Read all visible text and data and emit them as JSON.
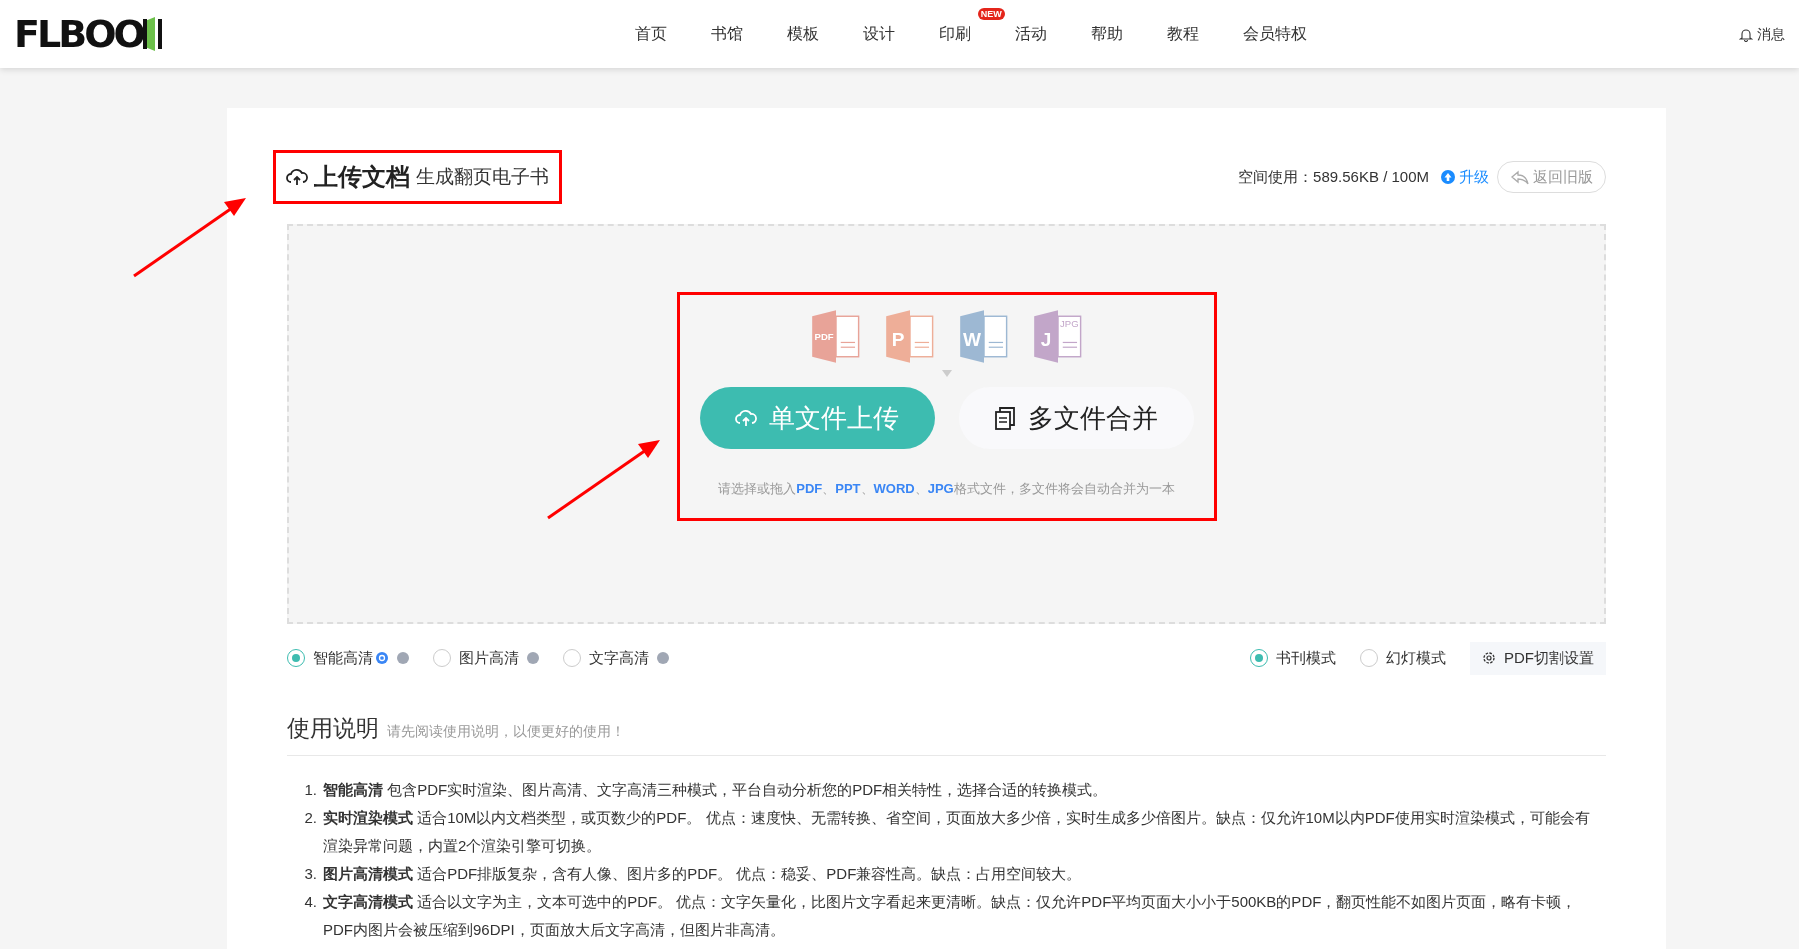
{
  "header": {
    "logo": "FLBOO",
    "nav": [
      {
        "label": "首页"
      },
      {
        "label": "书馆"
      },
      {
        "label": "模板"
      },
      {
        "label": "设计"
      },
      {
        "label": "印刷",
        "badge": "NEW"
      },
      {
        "label": "活动"
      },
      {
        "label": "帮助"
      },
      {
        "label": "教程"
      },
      {
        "label": "会员特权"
      }
    ],
    "messages": "消息"
  },
  "upload": {
    "title": "上传文档",
    "subtitle": "生成翻页电子书",
    "storage": "空间使用：589.56KB / 100M",
    "upgrade": "升级",
    "old_version": "返回旧版",
    "file_types": [
      {
        "label": "PDF",
        "color": "#e8a398"
      },
      {
        "label": "P",
        "color": "#eeae98"
      },
      {
        "label": "W",
        "color": "#9db8d3"
      },
      {
        "label": "J",
        "sublabel": "JPG",
        "color": "#c2a6c9"
      }
    ],
    "buttons": [
      {
        "label": "单文件上传",
        "kind": "primary"
      },
      {
        "label": "多文件合并",
        "kind": "secondary"
      }
    ],
    "hint": [
      {
        "text": "请选择或拖入",
        "kind": "plain"
      },
      {
        "text": "PDF",
        "kind": "format"
      },
      {
        "text": "、",
        "kind": "plain"
      },
      {
        "text": "PPT",
        "kind": "format"
      },
      {
        "text": "、",
        "kind": "plain"
      },
      {
        "text": "WORD",
        "kind": "format"
      },
      {
        "text": "、",
        "kind": "plain"
      },
      {
        "text": "JPG",
        "kind": "format"
      },
      {
        "text": "格式文件，多文件将会自动合并为一本",
        "kind": "plain"
      }
    ]
  },
  "quality_options": [
    {
      "label": "智能高清",
      "selected": true,
      "featured": true
    },
    {
      "label": "图片高清",
      "selected": false,
      "featured": false
    },
    {
      "label": "文字高清",
      "selected": false,
      "featured": false
    }
  ],
  "view_modes": [
    {
      "label": "书刊模式",
      "selected": true
    },
    {
      "label": "幻灯模式",
      "selected": false
    }
  ],
  "split_settings": "PDF切割设置",
  "instructions": {
    "title": "使用说明",
    "subtitle": "请先阅读使用说明，以便更好的使用！",
    "items": [
      {
        "number": "1.",
        "text": "**智能高清** 包含PDF实时渲染、图片高清、文字高清三种模式，平台自动分析您的PDF相关特性，选择合适的转换模式。"
      },
      {
        "number": "2.",
        "text": "**实时渲染模式** 适合10M以内文档类型，或页数少的PDF。 优点：速度快、无需转换、省空间，页面放大多少倍，实时生成多少倍图片。缺点：仅允许10M以内PDF使用实时渲染模式，可能会有渲染异常问题，内置2个渲染引擎可切换。"
      },
      {
        "number": "3.",
        "text": "**图片高清模式** 适合PDF排版复杂，含有人像、图片多的PDF。 优点：稳妥、PDF兼容性高。缺点：占用空间较大。"
      },
      {
        "number": "4.",
        "text": "**文字高清模式** 适合以文字为主，文本可选中的PDF。 优点：文字矢量化，比图片文字看起来更清晰。缺点：仅允许PDF平均页面大小小于500KB的PDF，翻页性能不如图片页面，略有卡顿，PDF内图片会被压缩到96DPI，页面放大后文字高清，但图片非高清。"
      }
    ]
  }
}
